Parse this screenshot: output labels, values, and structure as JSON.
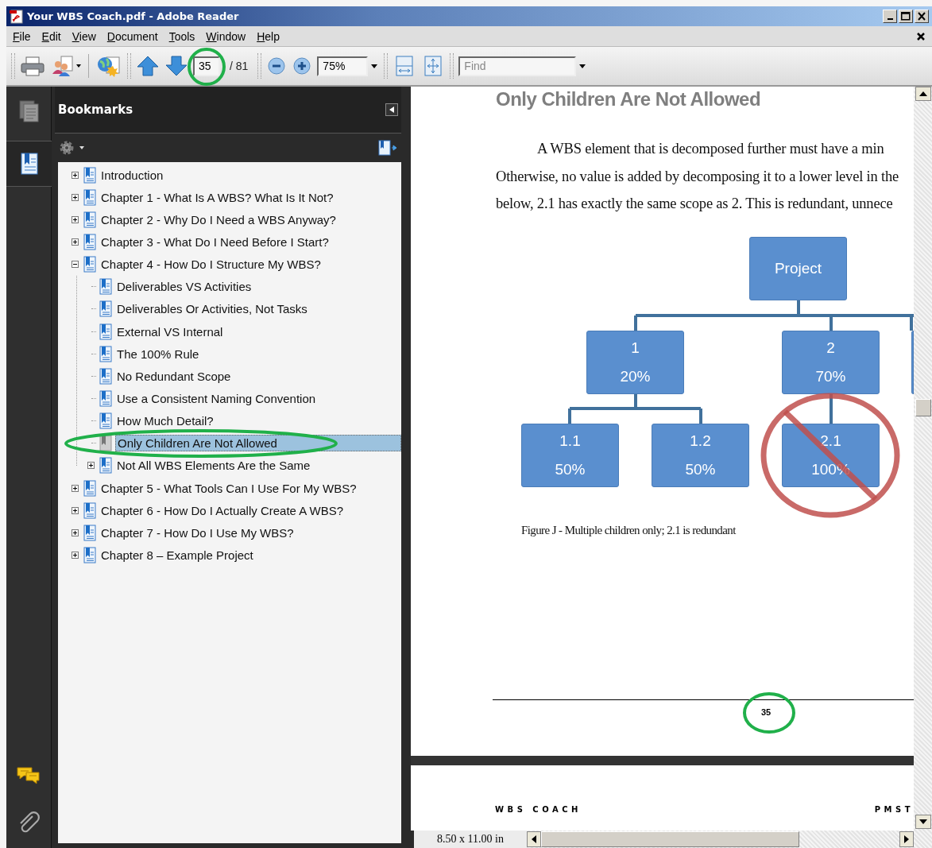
{
  "window": {
    "title": "Your WBS Coach.pdf - Adobe Reader"
  },
  "menu": [
    {
      "label": "File"
    },
    {
      "label": "Edit"
    },
    {
      "label": "View"
    },
    {
      "label": "Document"
    },
    {
      "label": "Tools"
    },
    {
      "label": "Window"
    },
    {
      "label": "Help"
    }
  ],
  "toolbar": {
    "page": {
      "value": "35",
      "circled": true
    },
    "page_count": "/ 81",
    "zoom": "75%",
    "find": {
      "placeholder": "Find"
    }
  },
  "nav_tabs": [
    {
      "kind": "pages",
      "selected": false
    },
    {
      "kind": "bookmarks",
      "selected": true
    }
  ],
  "bookmarks": {
    "title": "Bookmarks",
    "items": [
      {
        "label": "Introduction",
        "expanded": false,
        "selected": false
      },
      {
        "label": "Chapter 1 - What Is A WBS?  What Is It Not?",
        "expanded": false,
        "selected": false
      },
      {
        "label": "Chapter 2 - Why Do I Need a WBS Anyway?",
        "expanded": false,
        "selected": false
      },
      {
        "label": "Chapter 3 - What Do I Need Before I Start?",
        "expanded": false,
        "selected": false
      },
      {
        "label": "Chapter 4 - How Do I Structure My WBS?",
        "expanded": true,
        "selected": false,
        "children": [
          {
            "label": "Deliverables VS Activities",
            "selected": false
          },
          {
            "label": "Deliverables Or Activities, Not Tasks",
            "selected": false
          },
          {
            "label": "External VS Internal",
            "selected": false
          },
          {
            "label": "The 100% Rule",
            "selected": false
          },
          {
            "label": "No Redundant Scope",
            "selected": false
          },
          {
            "label": "Use a Consistent Naming Convention",
            "selected": false
          },
          {
            "label": "How Much Detail?",
            "selected": false
          },
          {
            "label": "Only Children Are Not Allowed",
            "selected": true,
            "circled": true
          },
          {
            "label": "Not All WBS Elements Are the Same",
            "expanded": false,
            "selected": false
          }
        ]
      },
      {
        "label": "Chapter 5 - What Tools Can I Use For My WBS?",
        "expanded": false,
        "selected": false
      },
      {
        "label": "Chapter 6 - How Do I Actually Create A WBS?",
        "expanded": false,
        "selected": false
      },
      {
        "label": "Chapter 7 - How Do I Use My WBS?",
        "expanded": false,
        "selected": false
      },
      {
        "label": "Chapter 8 – Example Project",
        "expanded": false,
        "selected": false
      }
    ]
  },
  "document": {
    "heading": "Only Children Are Not Allowed",
    "paragraph_lines": [
      "A WBS element that is decomposed further must have a min",
      "Otherwise, no value is added by decomposing it to a lower level in the",
      "below, 2.1 has exactly the same scope as 2.  This is redundant, unnece"
    ],
    "figure": {
      "nodes": [
        {
          "label": "Project",
          "crossed_out": false
        },
        {
          "label": "1",
          "share": "20%",
          "crossed_out": false
        },
        {
          "label": "2",
          "share": "70%",
          "crossed_out": false
        },
        {
          "label": "1.1",
          "share": "50%",
          "crossed_out": false
        },
        {
          "label": "1.2",
          "share": "50%",
          "crossed_out": false
        },
        {
          "label": "2.1",
          "share": "100%",
          "crossed_out": true
        }
      ]
    },
    "caption": "Figure J - Multiple children only; 2.1 is redundant",
    "page_number": {
      "text": "35",
      "circled": true
    },
    "next_page": {
      "header_left": "WBS COACH",
      "header_right": "PMST"
    }
  },
  "status_bar": {
    "page_size": "8.50 x 11.00 in"
  }
}
